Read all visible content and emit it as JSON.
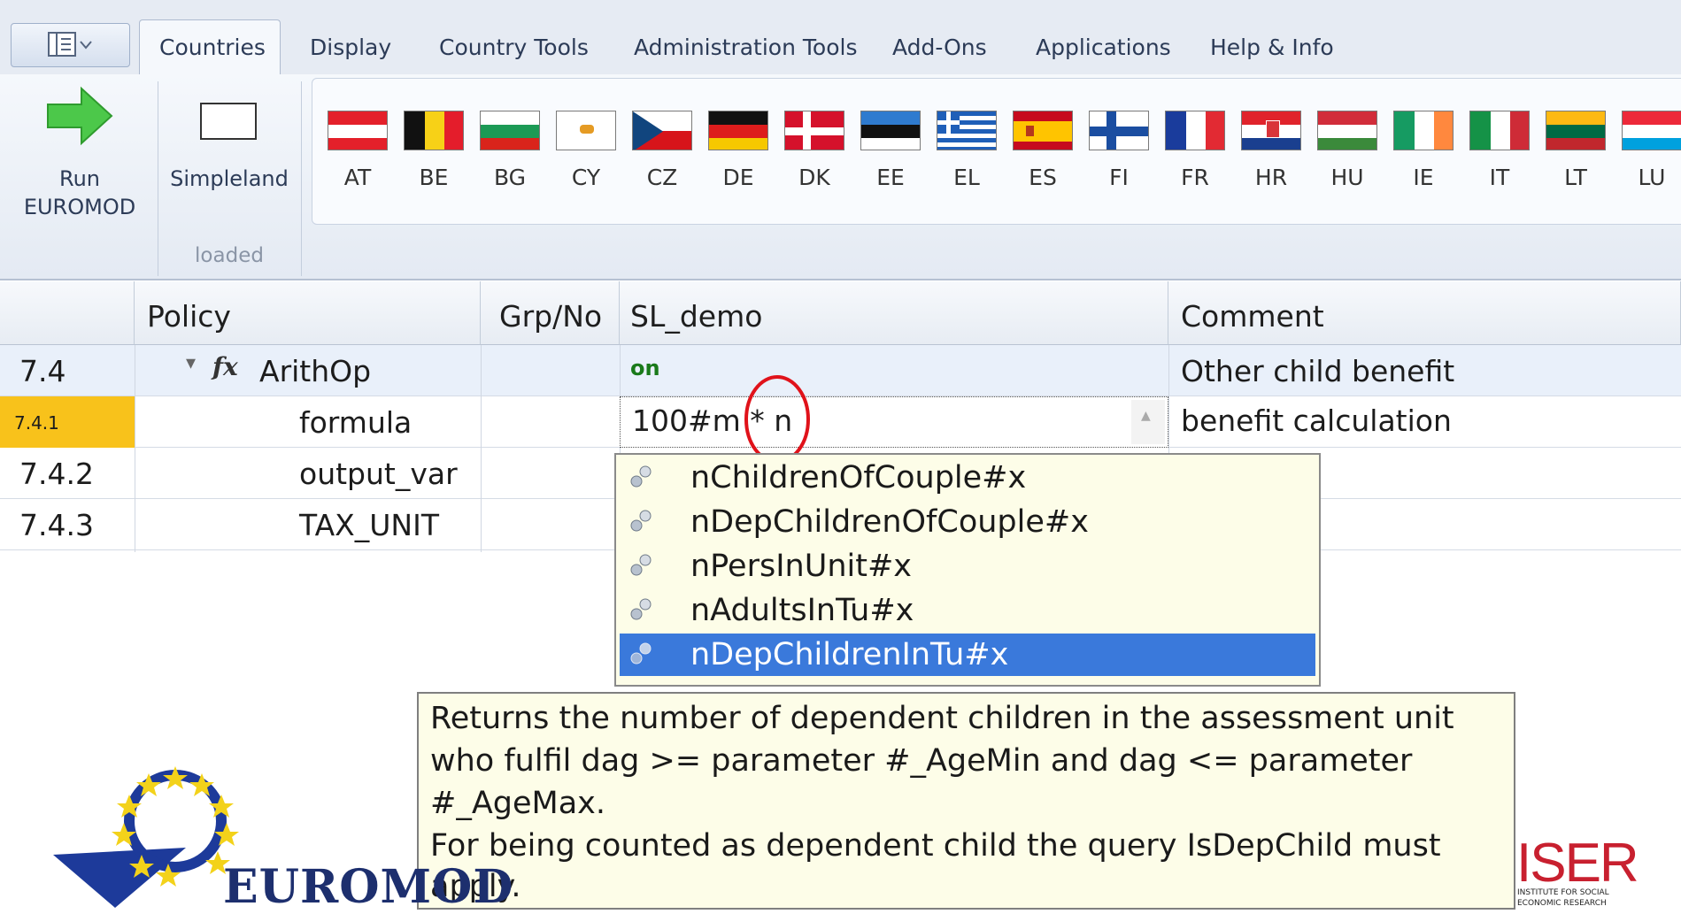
{
  "ribbon": {
    "tabs": [
      "Countries",
      "Display",
      "Country Tools",
      "Administration Tools",
      "Add-Ons",
      "Applications",
      "Help & Info"
    ],
    "active_tab": "Countries",
    "run_button": {
      "line1": "Run",
      "line2": "EUROMOD",
      "icon": "green-arrow-icon"
    },
    "simpleland_button": {
      "label": "Simpleland",
      "status": "loaded"
    },
    "countries": [
      "AT",
      "BE",
      "BG",
      "CY",
      "CZ",
      "DE",
      "DK",
      "EE",
      "EL",
      "ES",
      "FI",
      "FR",
      "HR",
      "HU",
      "IE",
      "IT",
      "LT",
      "LU"
    ]
  },
  "grid": {
    "headers": {
      "num": "",
      "policy": "Policy",
      "grp": "Grp/No",
      "system": "SL_demo",
      "comment": "Comment"
    },
    "rows": [
      {
        "num": "7.4",
        "name": "ArithOp",
        "value": "on",
        "comment": "Other child benefit"
      },
      {
        "num": "7.4.1",
        "name": "formula",
        "value": "100#m * n",
        "comment": "benefit calculation"
      },
      {
        "num": "7.4.2",
        "name": "output_var",
        "value": "",
        "comment": ""
      },
      {
        "num": "7.4.3",
        "name": "TAX_UNIT",
        "value": "",
        "comment": ""
      }
    ]
  },
  "autocomplete": {
    "items": [
      "nChildrenOfCouple#x",
      "nDepChildrenOfCouple#x",
      "nPersInUnit#x",
      "nAdultsInTu#x",
      "nDepChildrenInTu#x"
    ],
    "selected": "nDepChildrenInTu#x"
  },
  "tooltip": {
    "lines": [
      "Returns the number of dependent children in the assessment unit",
      "who fulfil dag >= parameter #_AgeMin and dag <= parameter",
      "#_AgeMax.",
      "For being counted as dependent child the query IsDepChild must",
      "apply."
    ]
  },
  "logos": {
    "euromod": "EUROMOD",
    "iser": "ISER",
    "iser_sub1": "INSTITUTE FOR SOCIAL",
    "iser_sub2": "ECONOMIC RESEARCH"
  },
  "colors": {
    "selected": "#3a79db",
    "highlight_cell": "#f8c21b",
    "on_text": "#1a7a1a",
    "annotation_circle": "#e0121a"
  }
}
